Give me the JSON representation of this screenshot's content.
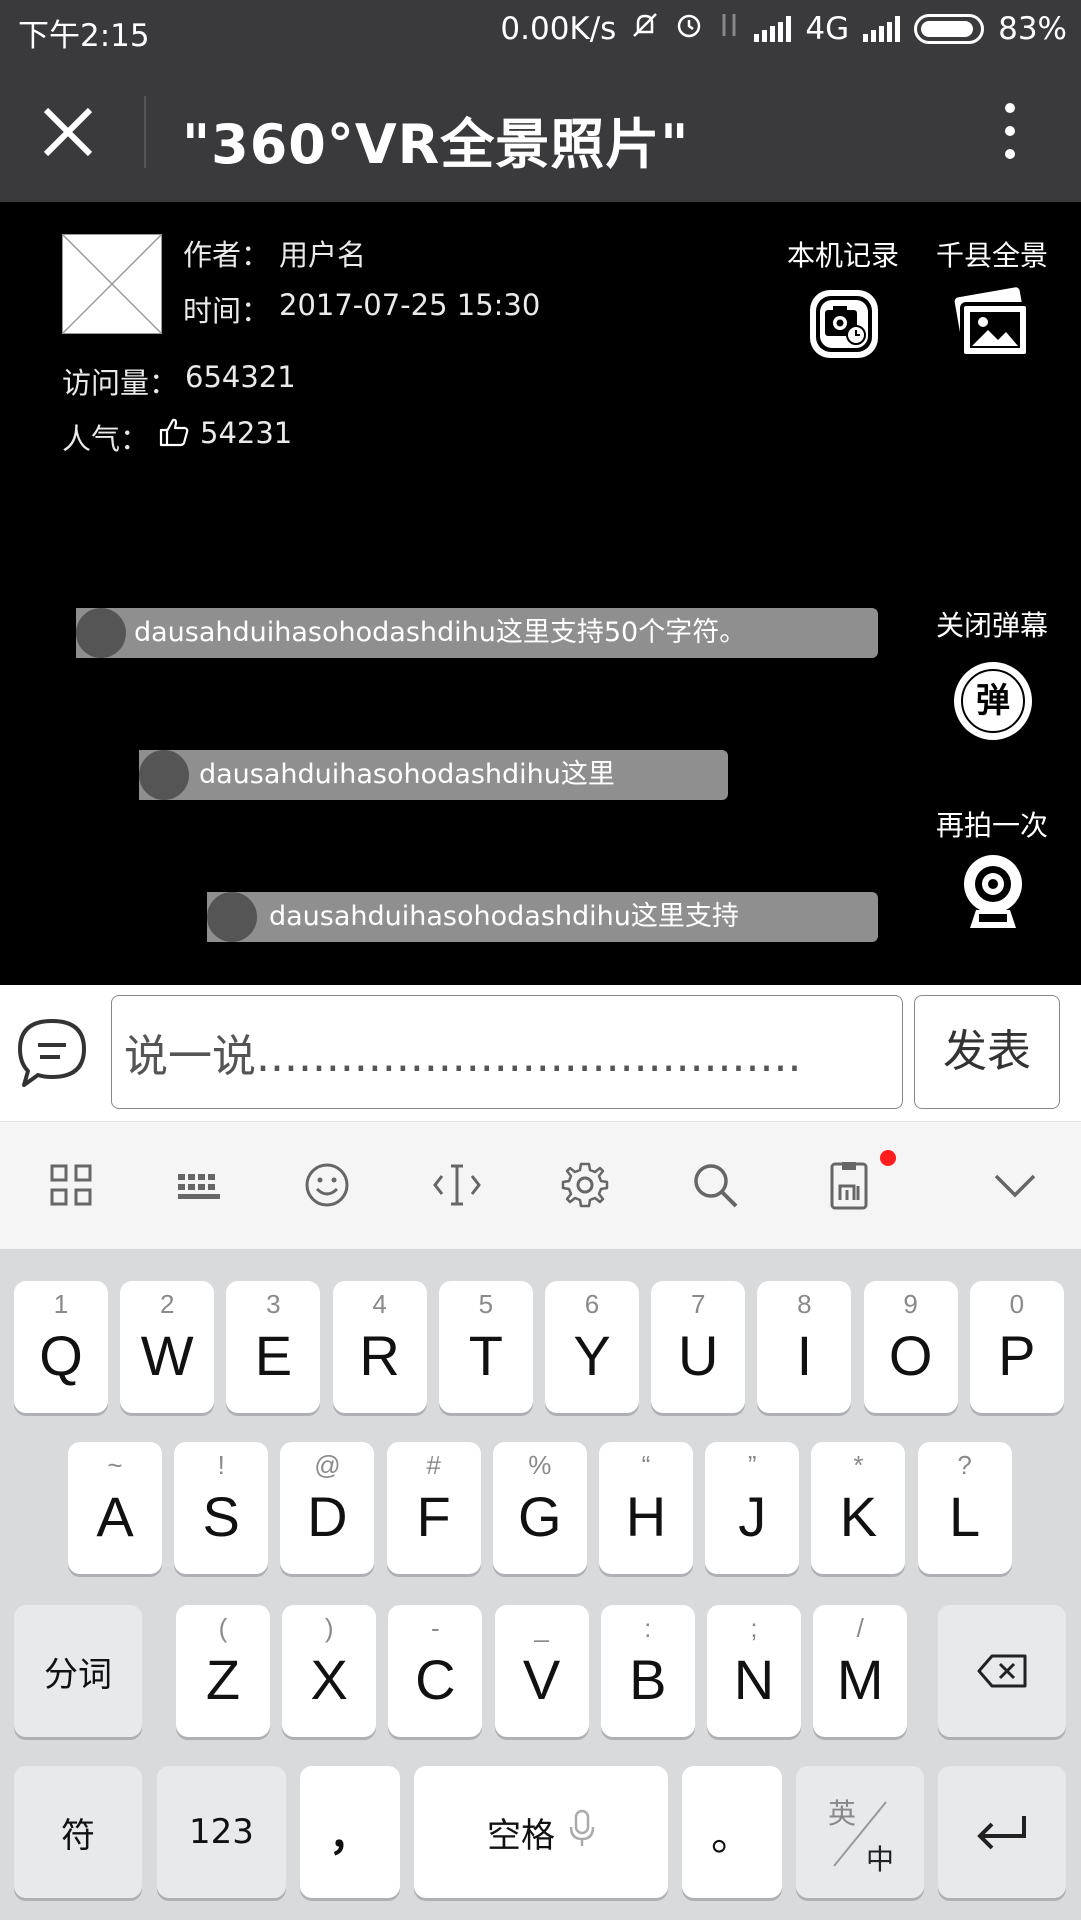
{
  "status_bar": {
    "time": "下午2:15",
    "net_speed": "0.00K/s",
    "network": "4G",
    "battery": "83%"
  },
  "header": {
    "title": "\"360°VR全景照片\""
  },
  "info": {
    "author_label": "作者：",
    "author": "用户名",
    "time_label": "时间：",
    "time": "2017-07-25 15:30",
    "views_label": "访问量：",
    "views": "654321",
    "popularity_label": "人气：",
    "likes": "54231"
  },
  "actions": {
    "local_record": "本机记录",
    "county_panorama": "千县全景",
    "close_danmu": "关闭弹幕",
    "shoot_again": "再拍一次",
    "danmu_badge": "弹"
  },
  "danmu": [
    "dausahduihasohodashdihu这里支持50个字符。",
    "dausahduihasohodashdihu这里",
    "dausahduihasohodashdihu这里支持"
  ],
  "comment": {
    "placeholder": "说一说.......................................",
    "send": "发表"
  },
  "keyboard": {
    "row1": [
      {
        "k": "Q",
        "h": "1"
      },
      {
        "k": "W",
        "h": "2"
      },
      {
        "k": "E",
        "h": "3"
      },
      {
        "k": "R",
        "h": "4"
      },
      {
        "k": "T",
        "h": "5"
      },
      {
        "k": "Y",
        "h": "6"
      },
      {
        "k": "U",
        "h": "7"
      },
      {
        "k": "I",
        "h": "8"
      },
      {
        "k": "O",
        "h": "9"
      },
      {
        "k": "P",
        "h": "0"
      }
    ],
    "row2": [
      {
        "k": "A",
        "h": "~"
      },
      {
        "k": "S",
        "h": "!"
      },
      {
        "k": "D",
        "h": "@"
      },
      {
        "k": "F",
        "h": "#"
      },
      {
        "k": "G",
        "h": "%"
      },
      {
        "k": "H",
        "h": "“"
      },
      {
        "k": "J",
        "h": "”"
      },
      {
        "k": "K",
        "h": "*"
      },
      {
        "k": "L",
        "h": "?"
      }
    ],
    "row3": [
      {
        "k": "Z",
        "h": "("
      },
      {
        "k": "X",
        "h": ")"
      },
      {
        "k": "C",
        "h": "-"
      },
      {
        "k": "V",
        "h": "_"
      },
      {
        "k": "B",
        "h": ":"
      },
      {
        "k": "N",
        "h": ";"
      },
      {
        "k": "M",
        "h": "/"
      }
    ],
    "segment": "分词",
    "symbol": "符",
    "num": "123",
    "comma": "，",
    "space": "空格",
    "period": "。",
    "lang_top": "英",
    "lang_bottom": "中"
  },
  "colors": {
    "bar_bg": "#3a3a3c",
    "content_bg": "#000000",
    "danmu_bg": "#8f8f8f",
    "keyboard_bg": "#d9dadc",
    "badge_red": "#ff1d1d"
  }
}
